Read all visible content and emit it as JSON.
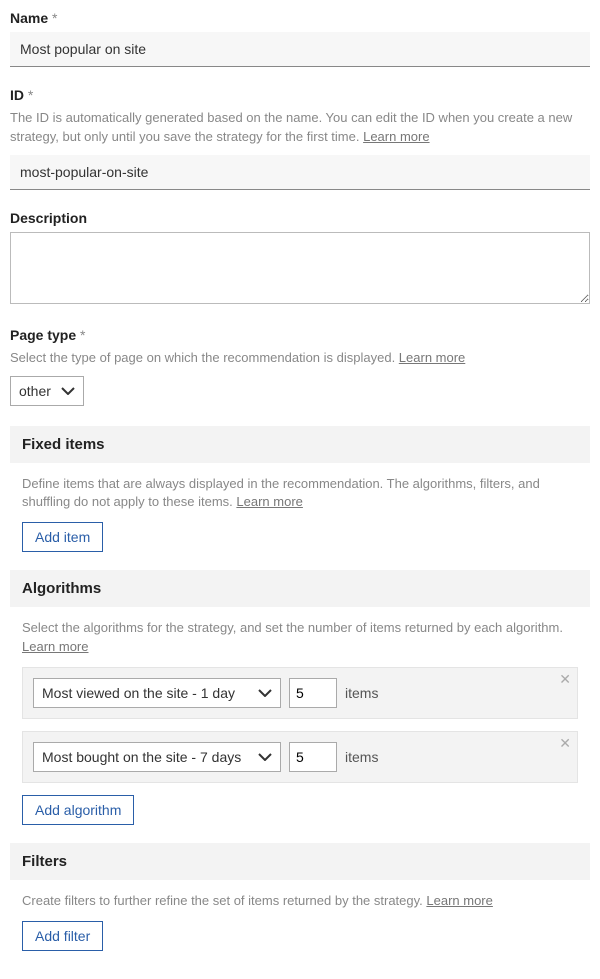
{
  "name": {
    "label": "Name",
    "value": "Most popular on site"
  },
  "id": {
    "label": "ID",
    "helper": "The ID is automatically generated based on the name. You can edit the ID when you create a new strategy, but only until you save the strategy for the first time. ",
    "learn_more": "Learn more",
    "value": "most-popular-on-site"
  },
  "description": {
    "label": "Description",
    "value": ""
  },
  "page_type": {
    "label": "Page type",
    "helper": "Select the type of page on which the recommendation is displayed. ",
    "learn_more": "Learn more",
    "value": "other"
  },
  "fixed_items": {
    "title": "Fixed items",
    "helper": "Define items that are always displayed in the recommendation. The algorithms, filters, and shuffling do not apply to these items. ",
    "learn_more": "Learn more",
    "add_button": "Add item"
  },
  "algorithms": {
    "title": "Algorithms",
    "helper": "Select the algorithms for the strategy, and set the number of items returned by each algorithm. ",
    "learn_more": "Learn more",
    "items_label": "items",
    "add_button": "Add algorithm",
    "rows": [
      {
        "label": "Most viewed on the site - 1 day",
        "count": "5"
      },
      {
        "label": "Most bought on the site - 7 days",
        "count": "5"
      }
    ]
  },
  "filters": {
    "title": "Filters",
    "helper": "Create filters to further refine the set of items returned by the strategy. ",
    "learn_more": "Learn more",
    "add_button": "Add filter"
  }
}
